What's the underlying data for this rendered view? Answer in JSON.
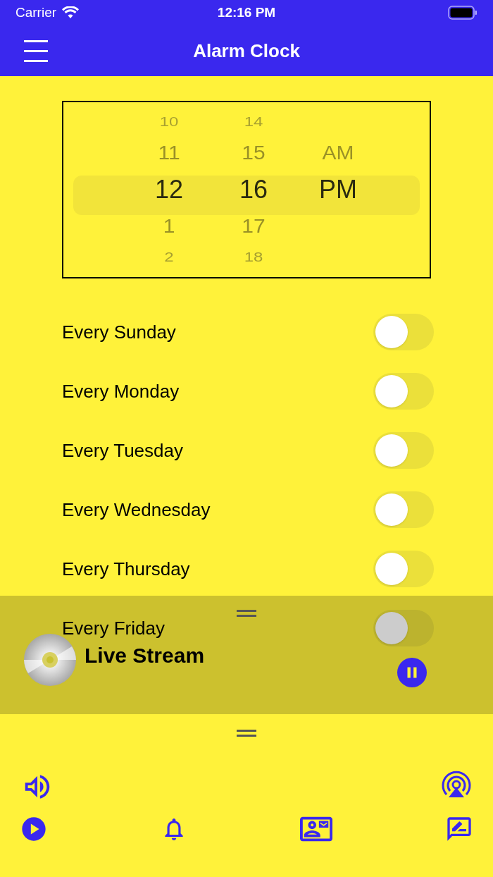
{
  "status_bar": {
    "carrier": "Carrier",
    "time": "12:16 PM"
  },
  "nav_bar": {
    "title": "Alarm Clock"
  },
  "time_picker": {
    "columns": [
      {
        "items": [
          {
            "label": "10",
            "selected": false
          },
          {
            "label": "11",
            "selected": false
          },
          {
            "label": "12",
            "selected": true
          },
          {
            "label": "1",
            "selected": false
          },
          {
            "label": "2",
            "selected": false
          }
        ]
      },
      {
        "items": [
          {
            "label": "14",
            "selected": false
          },
          {
            "label": "15",
            "selected": false
          },
          {
            "label": "16",
            "selected": true
          },
          {
            "label": "17",
            "selected": false
          },
          {
            "label": "18",
            "selected": false
          }
        ]
      },
      {
        "items": [
          {
            "label": "AM",
            "selected": false
          },
          {
            "label": "PM",
            "selected": true
          }
        ]
      }
    ]
  },
  "repeat_days": [
    {
      "label": "Every Sunday",
      "on": false
    },
    {
      "label": "Every Monday",
      "on": false
    },
    {
      "label": "Every Tuesday",
      "on": false
    },
    {
      "label": "Every Wednesday",
      "on": false
    },
    {
      "label": "Every Thursday",
      "on": false
    },
    {
      "label": "Every Friday",
      "on": false
    }
  ],
  "mini_player": {
    "title": "Live Stream",
    "playing": true
  }
}
